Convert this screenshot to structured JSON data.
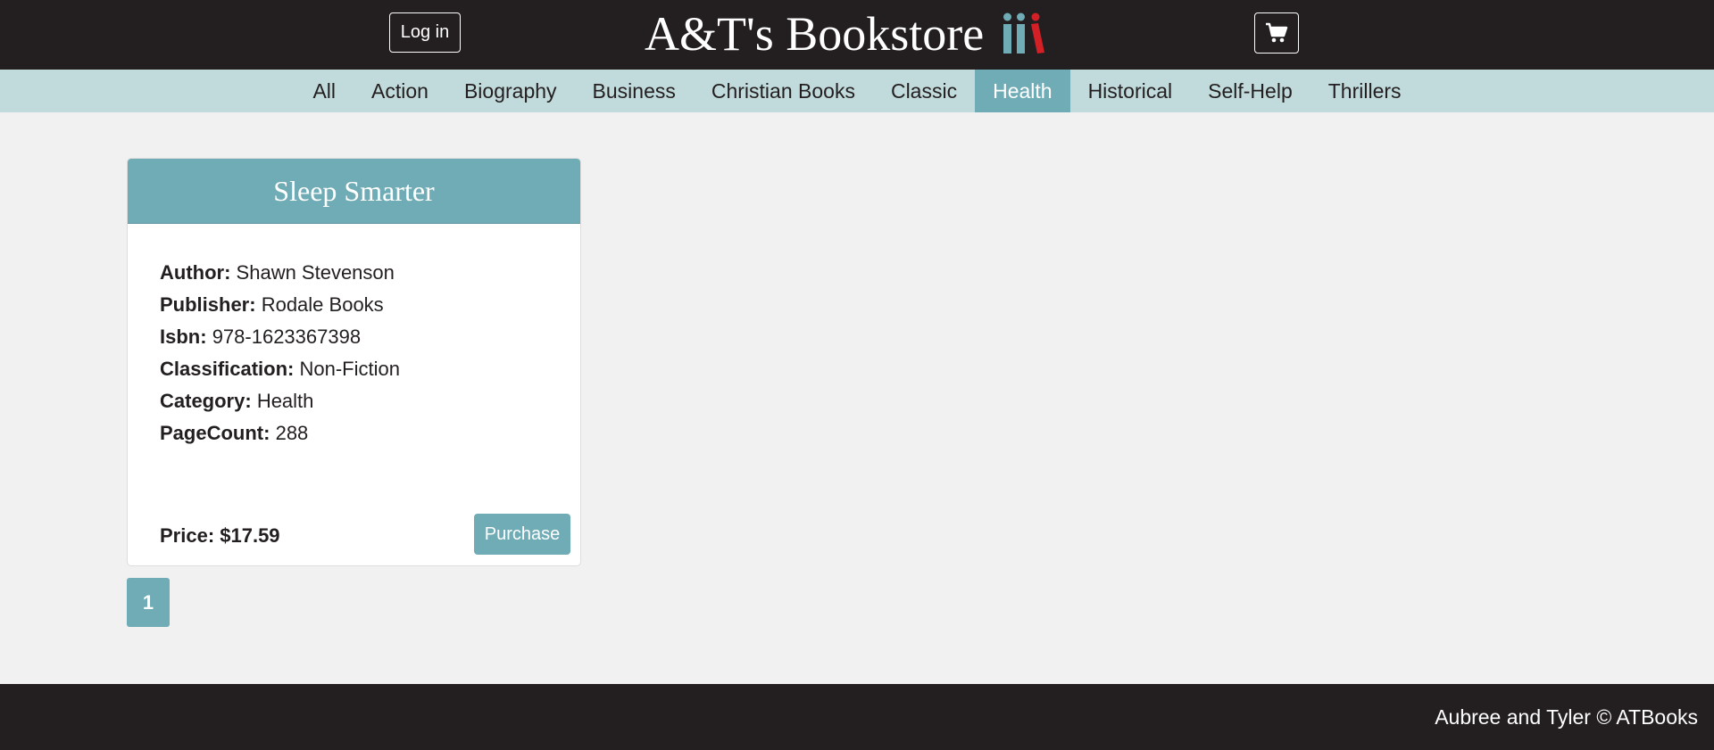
{
  "header": {
    "login_label": "Log in",
    "store_name": "A&T's Bookstore",
    "logo_icon": "books-logo-icon",
    "cart_icon": "shopping-cart-icon"
  },
  "categories": [
    {
      "label": "All",
      "active": false
    },
    {
      "label": "Action",
      "active": false
    },
    {
      "label": "Biography",
      "active": false
    },
    {
      "label": "Business",
      "active": false
    },
    {
      "label": "Christian Books",
      "active": false
    },
    {
      "label": "Classic",
      "active": false
    },
    {
      "label": "Health",
      "active": true
    },
    {
      "label": "Historical",
      "active": false
    },
    {
      "label": "Self-Help",
      "active": false
    },
    {
      "label": "Thrillers",
      "active": false
    }
  ],
  "book": {
    "title": "Sleep Smarter",
    "details": [
      {
        "label": "Author:",
        "value": "Shawn Stevenson"
      },
      {
        "label": "Publisher:",
        "value": "Rodale Books"
      },
      {
        "label": "Isbn:",
        "value": "978-1623367398"
      },
      {
        "label": "Classification:",
        "value": "Non-Fiction"
      },
      {
        "label": "Category:",
        "value": "Health"
      },
      {
        "label": "PageCount:",
        "value": "288"
      }
    ],
    "price": "Price: $17.59",
    "purchase_label": "Purchase"
  },
  "pagination": {
    "current_page": "1"
  },
  "footer": {
    "text": "Aubree and Tyler © ATBooks"
  },
  "colors": {
    "header_bg": "#231f20",
    "nav_bg": "#c1dadb",
    "accent": "#70acb6",
    "logo_red": "#d32027"
  }
}
